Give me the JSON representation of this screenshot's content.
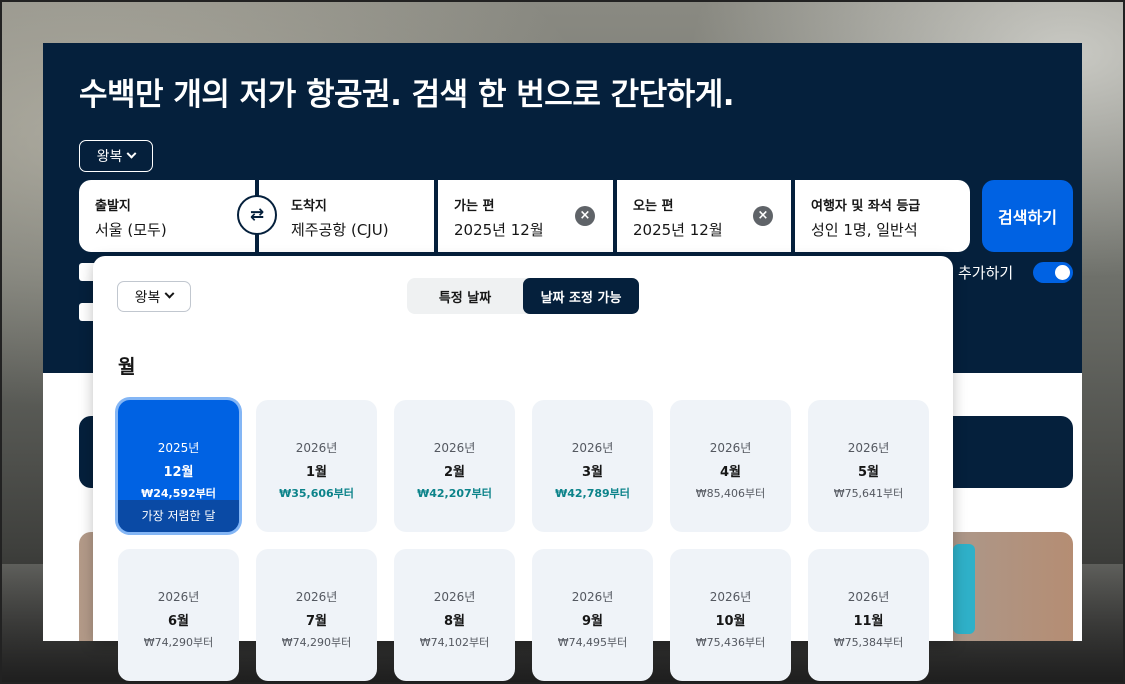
{
  "hero": {
    "title": "수백만 개의 저가 항공권. 검색 한 번으로 간단하게.",
    "trip_type": "왕복"
  },
  "search": {
    "origin": {
      "label": "출발지",
      "value": "서울 (모두)"
    },
    "destination": {
      "label": "도착지",
      "value": "제주공항 (CJU)"
    },
    "depart": {
      "label": "가는 편",
      "value": "2025년 12월"
    },
    "return": {
      "label": "오는 편",
      "value": "2025년 12월"
    },
    "travellers": {
      "label": "여행자 및 좌석 등급",
      "value": "성인 1명, 일반석"
    },
    "search_button": "검색하기",
    "add_label": "추가하기",
    "toggle_on": true
  },
  "picker": {
    "trip_type": "왕복",
    "tabs": [
      {
        "label": "특정 날짜",
        "active": false
      },
      {
        "label": "날짜 조정 가능",
        "active": true
      }
    ],
    "section_title": "월",
    "months": [
      {
        "year": "2025년",
        "month": "12월",
        "price": "₩24,592부터",
        "selected": true,
        "badge": "가장 저렴한 달"
      },
      {
        "year": "2026년",
        "month": "1월",
        "price": "₩35,606부터",
        "cheap": true
      },
      {
        "year": "2026년",
        "month": "2월",
        "price": "₩42,207부터",
        "cheap": true
      },
      {
        "year": "2026년",
        "month": "3월",
        "price": "₩42,789부터",
        "cheap": true
      },
      {
        "year": "2026년",
        "month": "4월",
        "price": "₩85,406부터"
      },
      {
        "year": "2026년",
        "month": "5월",
        "price": "₩75,641부터"
      },
      {
        "year": "2026년",
        "month": "6월",
        "price": "₩74,290부터"
      },
      {
        "year": "2026년",
        "month": "7월",
        "price": "₩74,290부터"
      },
      {
        "year": "2026년",
        "month": "8월",
        "price": "₩74,102부터"
      },
      {
        "year": "2026년",
        "month": "9월",
        "price": "₩74,495부터"
      },
      {
        "year": "2026년",
        "month": "10월",
        "price": "₩75,436부터"
      },
      {
        "year": "2026년",
        "month": "11월",
        "price": "₩75,384부터"
      }
    ]
  },
  "colors": {
    "hero_bg": "#05203c",
    "accent": "#0062e3",
    "cheap_price": "#0c838a"
  },
  "icons": {
    "swap": "swap-arrows-icon",
    "clear": "close-circle-icon",
    "dropdown": "chevron-down-icon"
  }
}
